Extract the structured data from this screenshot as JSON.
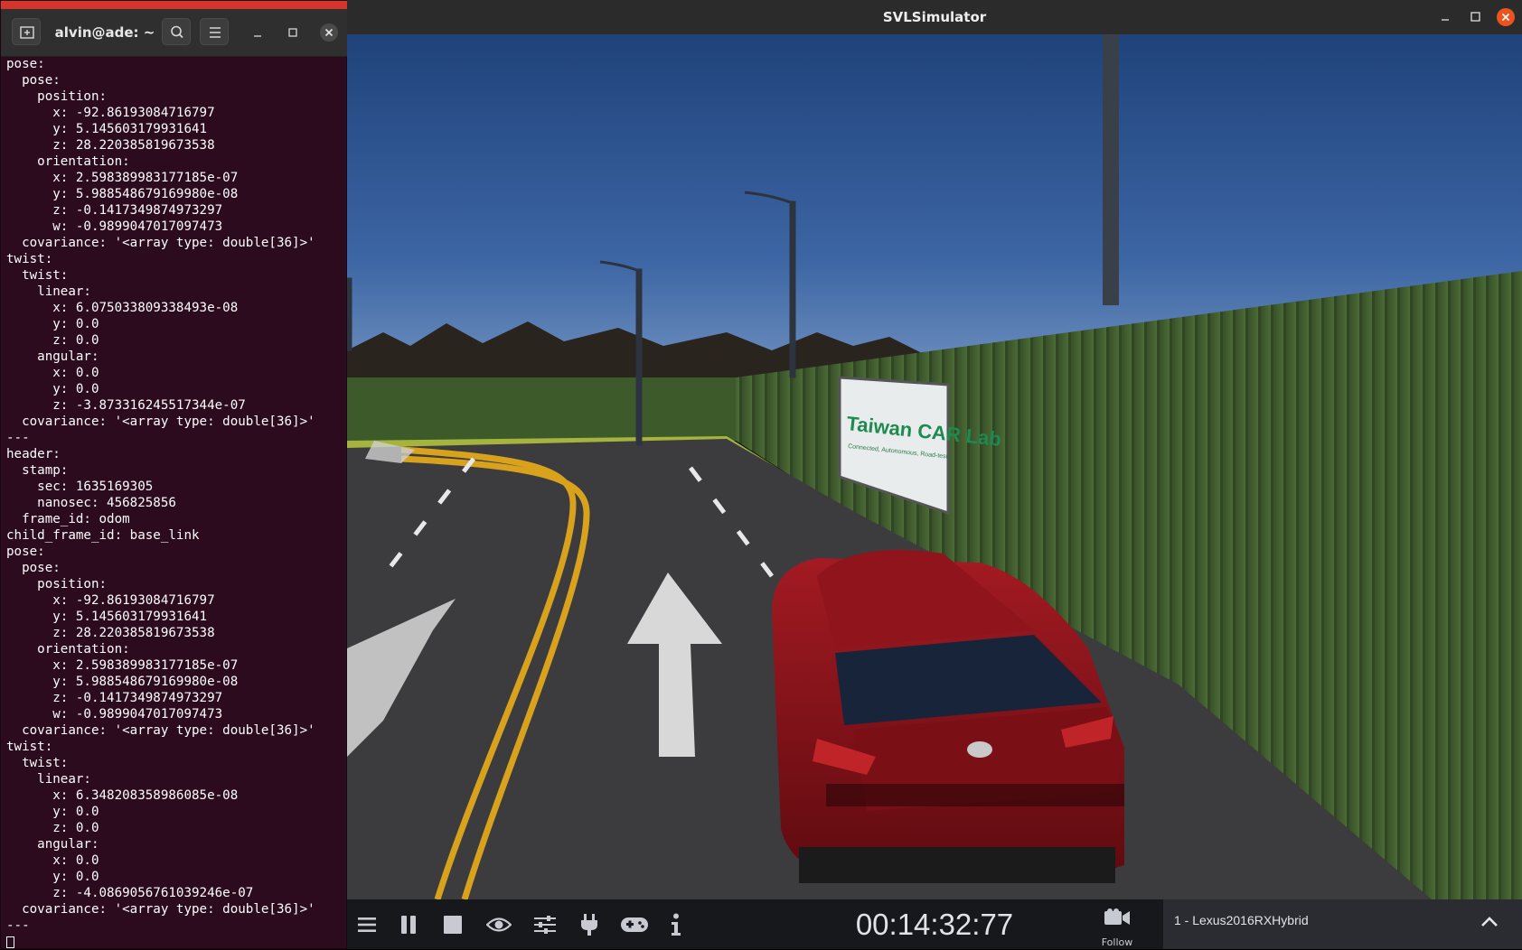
{
  "terminal": {
    "title": "alvin@ade: ~",
    "icons": {
      "new_tab": "new-tab-icon",
      "search": "search-icon",
      "menu": "hamburger-menu-icon",
      "minimize": "minimize-icon",
      "maximize": "maximize-icon",
      "close": "close-icon"
    },
    "output": "pose:\n  pose:\n    position:\n      x: -92.86193084716797\n      y: 5.145603179931641\n      z: 28.220385819673538\n    orientation:\n      x: 2.598389983177185e-07\n      y: 5.988548679169980e-08\n      z: -0.1417349874973297\n      w: -0.9899047017097473\n  covariance: '<array type: double[36]>'\ntwist:\n  twist:\n    linear:\n      x: 6.075033809338493e-08\n      y: 0.0\n      z: 0.0\n    angular:\n      x: 0.0\n      y: 0.0\n      z: -3.873316245517344e-07\n  covariance: '<array type: double[36]>'\n---\nheader:\n  stamp:\n    sec: 1635169305\n    nanosec: 456825856\n  frame_id: odom\nchild_frame_id: base_link\npose:\n  pose:\n    position:\n      x: -92.86193084716797\n      y: 5.145603179931641\n      z: 28.220385819673538\n    orientation:\n      x: 2.598389983177185e-07\n      y: 5.988548679169980e-08\n      z: -0.1417349874973297\n      w: -0.9899047017097473\n  covariance: '<array type: double[36]>'\ntwist:\n  twist:\n    linear:\n      x: 6.348208358986085e-08\n      y: 0.0\n      z: 0.0\n    angular:\n      x: 0.0\n      y: 0.0\n      z: -4.0869056761039246e-07\n  covariance: '<array type: double[36]>'\n---"
  },
  "simulator": {
    "title": "SVLSimulator",
    "icons": {
      "minimize": "minimize-icon",
      "maximize": "maximize-icon",
      "close": "close-icon"
    },
    "scene": {
      "billboard_text_line1": "Taiwan CAR Lab",
      "billboard_text_line2": "Connected, Autonomous, Road-test",
      "sky_color": "#2a4f86",
      "fence_color": "#3e5a2d",
      "car_color": "#8b1019"
    },
    "toolbar": {
      "menu_icon": "hamburger-menu-icon",
      "pause_icon": "pause-icon",
      "stop_icon": "stop-icon",
      "visibility_icon": "eye-icon",
      "settings_icon": "sliders-icon",
      "plugin_icon": "plug-icon",
      "controls_icon": "gamepad-icon",
      "info_icon": "info-icon",
      "time": "00:14:32:77",
      "camera_icon": "video-camera-icon",
      "follow_label": "Follow",
      "vehicle": "1 - Lexus2016RXHybrid",
      "expand_icon": "chevron-up-icon"
    }
  }
}
